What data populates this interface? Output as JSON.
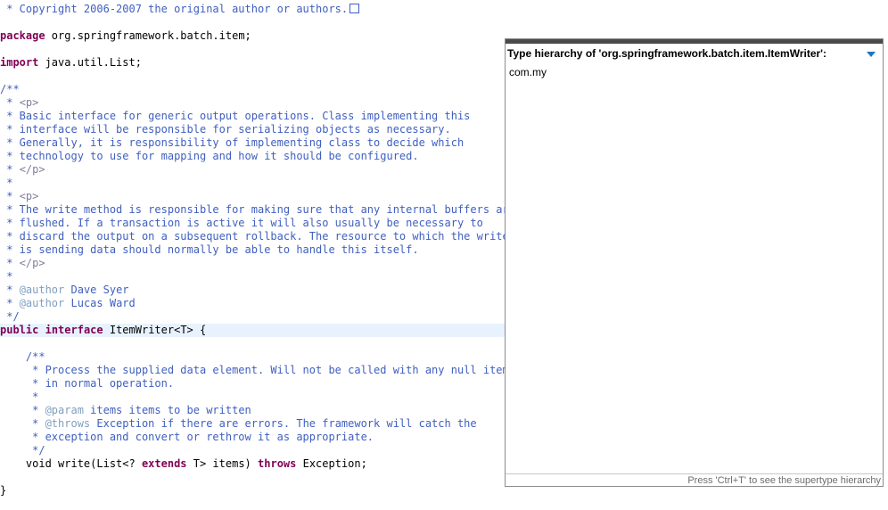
{
  "editor": {
    "lines": [
      {
        "segments": [
          {
            "t": " * Copyright 2006-2007 the original author or authors.",
            "c": "jd"
          }
        ],
        "fold": true
      },
      {
        "segments": []
      },
      {
        "segments": [
          {
            "t": "package",
            "c": "kw"
          },
          {
            "t": " org.springframework.batch.item;",
            "c": ""
          }
        ]
      },
      {
        "segments": []
      },
      {
        "segments": [
          {
            "t": "import",
            "c": "kw"
          },
          {
            "t": " java.util.List;",
            "c": ""
          }
        ]
      },
      {
        "segments": []
      },
      {
        "segments": [
          {
            "t": "/**",
            "c": "jd"
          }
        ]
      },
      {
        "segments": [
          {
            "t": " * ",
            "c": "jd"
          },
          {
            "t": "<p>",
            "c": "tag"
          }
        ]
      },
      {
        "segments": [
          {
            "t": " * Basic interface for generic output operations. Class implementing this",
            "c": "jd"
          }
        ]
      },
      {
        "segments": [
          {
            "t": " * interface will be responsible for serializing objects as necessary.",
            "c": "jd"
          }
        ]
      },
      {
        "segments": [
          {
            "t": " * Generally, it is responsibility of implementing class to decide which",
            "c": "jd"
          }
        ]
      },
      {
        "segments": [
          {
            "t": " * technology to use for mapping and how it should be configured.",
            "c": "jd"
          }
        ]
      },
      {
        "segments": [
          {
            "t": " * ",
            "c": "jd"
          },
          {
            "t": "</p>",
            "c": "tag"
          }
        ]
      },
      {
        "segments": [
          {
            "t": " *",
            "c": "jd"
          }
        ]
      },
      {
        "segments": [
          {
            "t": " * ",
            "c": "jd"
          },
          {
            "t": "<p>",
            "c": "tag"
          }
        ]
      },
      {
        "segments": [
          {
            "t": " * The write method is responsible for making sure that any internal buffers are",
            "c": "jd"
          }
        ]
      },
      {
        "segments": [
          {
            "t": " * flushed. If a transaction is active it will also usually be necessary to",
            "c": "jd"
          }
        ]
      },
      {
        "segments": [
          {
            "t": " * discard the output on a subsequent rollback. The resource to which the writer",
            "c": "jd"
          }
        ]
      },
      {
        "segments": [
          {
            "t": " * is sending data should normally be able to handle this itself.",
            "c": "jd"
          }
        ]
      },
      {
        "segments": [
          {
            "t": " * ",
            "c": "jd"
          },
          {
            "t": "</p>",
            "c": "tag"
          }
        ]
      },
      {
        "segments": [
          {
            "t": " *",
            "c": "jd"
          }
        ]
      },
      {
        "segments": [
          {
            "t": " * ",
            "c": "jd"
          },
          {
            "t": "@author",
            "c": "annot"
          },
          {
            "t": " Dave Syer",
            "c": "jd"
          }
        ]
      },
      {
        "segments": [
          {
            "t": " * ",
            "c": "jd"
          },
          {
            "t": "@author",
            "c": "annot"
          },
          {
            "t": " Lucas Ward",
            "c": "jd"
          }
        ]
      },
      {
        "segments": [
          {
            "t": " */",
            "c": "jd"
          }
        ]
      },
      {
        "segments": [
          {
            "t": "public",
            "c": "kw"
          },
          {
            "t": " ",
            "c": ""
          },
          {
            "t": "interface",
            "c": "kw"
          },
          {
            "t": " ItemWriter<T> {",
            "c": ""
          }
        ],
        "current": true
      },
      {
        "segments": []
      },
      {
        "segments": [
          {
            "t": "    /**",
            "c": "jd"
          }
        ]
      },
      {
        "segments": [
          {
            "t": "     * Process the supplied data element. Will not be called with any null items",
            "c": "jd"
          }
        ]
      },
      {
        "segments": [
          {
            "t": "     * in normal operation.",
            "c": "jd"
          }
        ]
      },
      {
        "segments": [
          {
            "t": "     *",
            "c": "jd"
          }
        ]
      },
      {
        "segments": [
          {
            "t": "     * ",
            "c": "jd"
          },
          {
            "t": "@param",
            "c": "annot"
          },
          {
            "t": " items items to be written",
            "c": "jd"
          }
        ]
      },
      {
        "segments": [
          {
            "t": "     * ",
            "c": "jd"
          },
          {
            "t": "@throws",
            "c": "annot"
          },
          {
            "t": " Exception if there are errors. The framework will catch the",
            "c": "jd"
          }
        ]
      },
      {
        "segments": [
          {
            "t": "     * exception and convert or rethrow it as appropriate.",
            "c": "jd"
          }
        ]
      },
      {
        "segments": [
          {
            "t": "     */",
            "c": "jd"
          }
        ]
      },
      {
        "segments": [
          {
            "t": "    void write(List<? ",
            "c": ""
          },
          {
            "t": "extends",
            "c": "kw"
          },
          {
            "t": " T> items) ",
            "c": ""
          },
          {
            "t": "throws",
            "c": "kw"
          },
          {
            "t": " Exception;",
            "c": ""
          }
        ]
      },
      {
        "segments": []
      },
      {
        "segments": [
          {
            "t": "}",
            "c": ""
          }
        ]
      }
    ]
  },
  "popup": {
    "title": "Type hierarchy of 'org.springframework.batch.item.ItemWriter':",
    "menu_icon": "triangle-down-icon",
    "filter_value": "com.my",
    "status": "Press 'Ctrl+T' to see the supertype hierarchy"
  },
  "colors": {
    "keyword": "#7f0055",
    "javadoc": "#3f5fbf",
    "javadoc_tag": "#7f7f9f",
    "javadoc_annotation": "#7f9fbf",
    "current_line": "#e8f2fe",
    "menu_icon": "#1e74c6"
  }
}
